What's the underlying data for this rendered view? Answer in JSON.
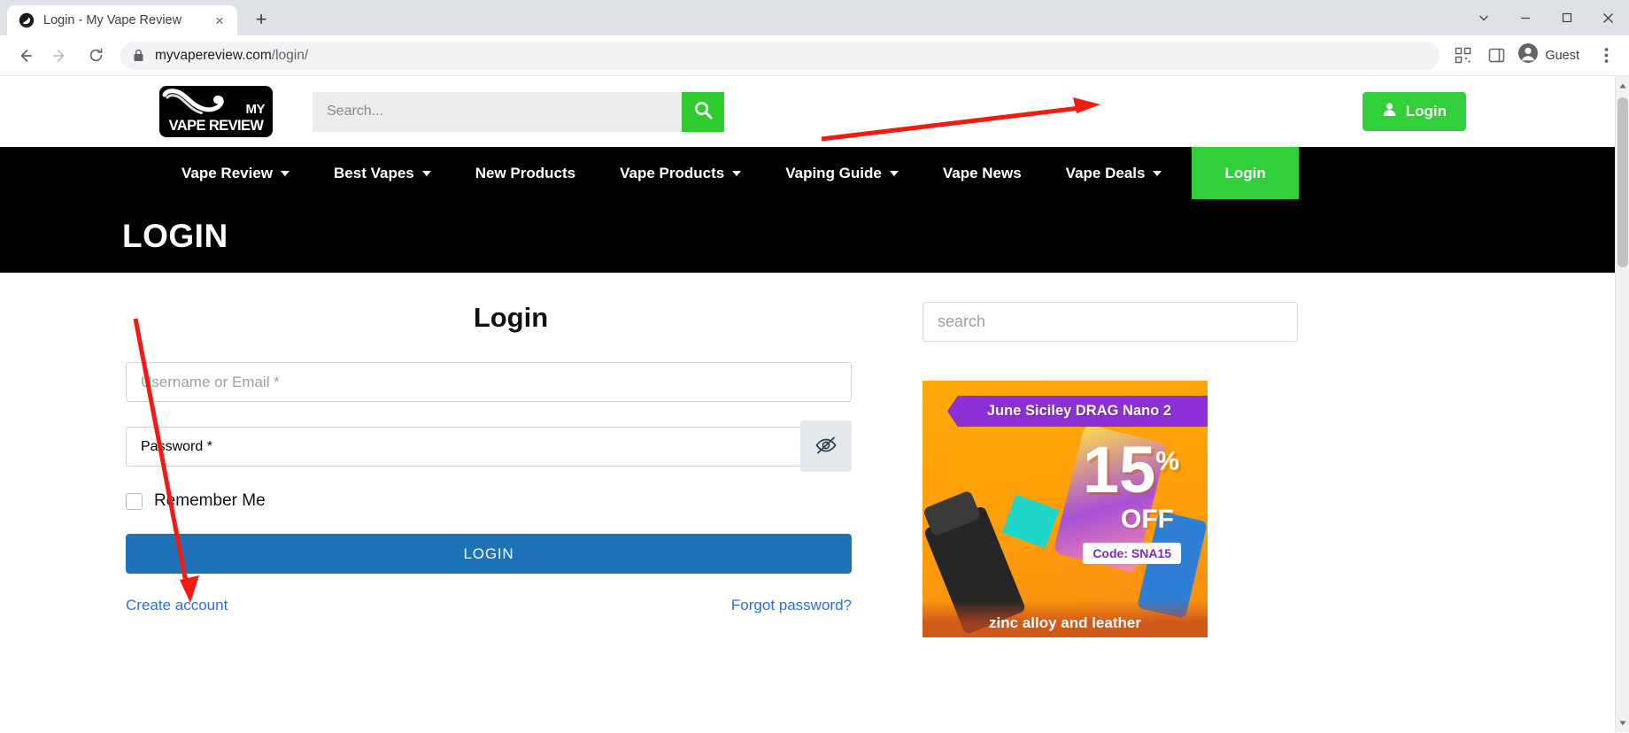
{
  "browser": {
    "tab": {
      "title": "Login - My Vape Review",
      "favicon": "browser-logo-icon",
      "close": "×"
    },
    "new_tab_label": "+",
    "url_primary": "myvapereview.com",
    "url_path": "/login/",
    "profile_name": "Guest",
    "icons": {
      "back": "back-arrow-icon",
      "forward": "forward-arrow-icon",
      "reload": "reload-icon",
      "lock": "lock-icon",
      "qr": "qr-code-icon",
      "sidepanel": "side-panel-icon",
      "avatar": "avatar-icon",
      "menu": "three-dot-menu-icon",
      "minimize": "minimize-icon",
      "maximize": "maximize-icon",
      "close": "window-close-icon",
      "tab_list": "tab-list-chevron-icon"
    }
  },
  "site": {
    "logo": {
      "my": "MY",
      "name": "VAPE REVIEW"
    },
    "search": {
      "placeholder": "Search...",
      "value": "",
      "button_icon": "search-icon"
    },
    "header_login": {
      "label": "Login",
      "icon": "user-icon",
      "color": "#31cf3a"
    },
    "nav": [
      {
        "label": "Vape Review",
        "caret": true
      },
      {
        "label": "Best Vapes",
        "caret": true
      },
      {
        "label": "New Products",
        "caret": false
      },
      {
        "label": "Vape Products",
        "caret": true
      },
      {
        "label": "Vaping Guide",
        "caret": true
      },
      {
        "label": "Vape News",
        "caret": false
      },
      {
        "label": "Vape Deals",
        "caret": true
      },
      {
        "label": "Login",
        "caret": false,
        "cta": true
      }
    ],
    "page_title": "LOGIN"
  },
  "login_form": {
    "heading": "Login",
    "username": {
      "placeholder": "Username or Email *",
      "value": ""
    },
    "password": {
      "placeholder": "Password *",
      "value": "",
      "toggle_icon": "eye-slash-icon"
    },
    "remember": {
      "label": "Remember Me",
      "checked": false
    },
    "submit_label": "LOGIN",
    "submit_color": "#1d72b8",
    "create_account": "Create account",
    "forgot_password": "Forgot password?"
  },
  "sidebar": {
    "search": {
      "placeholder": "search",
      "value": ""
    },
    "ad": {
      "ribbon": "June Siciley DRAG Nano 2",
      "percent": "15",
      "percent_sup": "%",
      "off": "OFF",
      "code": "Code: SNA15",
      "footer": "zinc alloy and leather"
    }
  },
  "annotations": {
    "arrow_to_header_login": "red-arrow",
    "arrow_to_create_account": "red-arrow",
    "color": "#f41a12"
  }
}
